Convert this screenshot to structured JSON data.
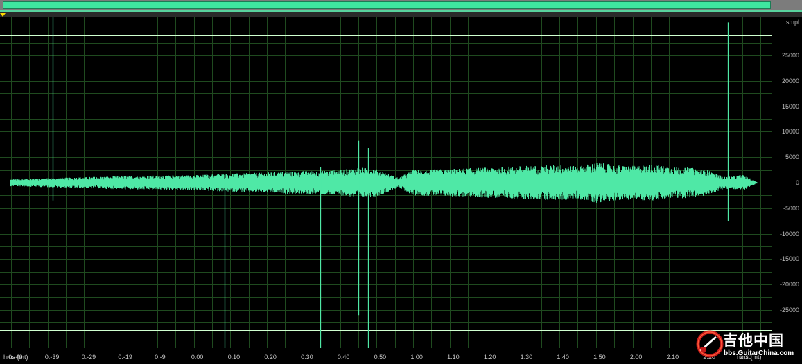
{
  "overview": {
    "region_fraction": [
      0.0,
      1.0
    ]
  },
  "colors": {
    "waveform": "#4fe8a6",
    "grid": "#1f4a1f",
    "clip_line": "#d0ffd0",
    "zero_line": "#8a8a8a",
    "overview_bar": "#3fe6a0",
    "cursor_marker": "#ffd800"
  },
  "vertical_ruler": {
    "unit": "smpl",
    "labels": [
      "25000",
      "20000",
      "15000",
      "10000",
      "5000",
      "0",
      "-5000",
      "-10000",
      "-15000",
      "-20000",
      "-25000"
    ]
  },
  "time_ruler": {
    "unit_label": "hms (mt)",
    "labels": [
      "0:-49",
      "0:-39",
      "0:-29",
      "0:-19",
      "0:-9",
      "0:00",
      "0:10",
      "0:20",
      "0:30",
      "0:40",
      "0:50",
      "1:00",
      "1:10",
      "1:20",
      "1:30",
      "1:40",
      "1:50",
      "2:00",
      "2:10",
      "2:20",
      "2:30"
    ],
    "end_label": "hms (mt)"
  },
  "watermark": {
    "title": "吉他中国",
    "url": "bbs.GuitarChina.com"
  },
  "chart_data": {
    "type": "line",
    "title": "",
    "xlabel": "hms (mt)",
    "ylabel": "smpl",
    "x_unit": "seconds",
    "xlim": [
      -53,
      158
    ],
    "ylim": [
      -32500,
      32500
    ],
    "clip_level": 29000,
    "grid": true,
    "envelope": {
      "x": [
        -50,
        -40,
        -30,
        -20,
        -10,
        0,
        10,
        20,
        30,
        40,
        45,
        50,
        56,
        60,
        70,
        80,
        90,
        100,
        105,
        110,
        115,
        120,
        125,
        130,
        135,
        140,
        145,
        148,
        150,
        154
      ],
      "max": [
        700,
        900,
        1100,
        1300,
        1400,
        1500,
        1800,
        2000,
        2300,
        2500,
        3000,
        2700,
        1000,
        2500,
        2700,
        3000,
        3300,
        3500,
        3200,
        4000,
        3500,
        3300,
        3600,
        3200,
        3000,
        2600,
        1200,
        1300,
        1600,
        200
      ],
      "min": [
        -700,
        -900,
        -1100,
        -1300,
        -1400,
        -1500,
        -1800,
        -2000,
        -2300,
        -2500,
        -3000,
        -2700,
        -1000,
        -2500,
        -2700,
        -3000,
        -3300,
        -3500,
        -3200,
        -4000,
        -3500,
        -3300,
        -3600,
        -3200,
        -3000,
        -2600,
        -1200,
        -1300,
        -1600,
        -200
      ]
    },
    "spikes": [
      {
        "x": -38.5,
        "min": -3500,
        "max": 32500
      },
      {
        "x": 8.5,
        "min": -32500,
        "max": 0
      },
      {
        "x": 34.6,
        "min": -32500,
        "max": 3000
      },
      {
        "x": 45.0,
        "min": -26000,
        "max": 8200
      },
      {
        "x": 47.7,
        "min": -32500,
        "max": 6800
      },
      {
        "x": 146.1,
        "min": -7500,
        "max": 31500
      }
    ]
  }
}
